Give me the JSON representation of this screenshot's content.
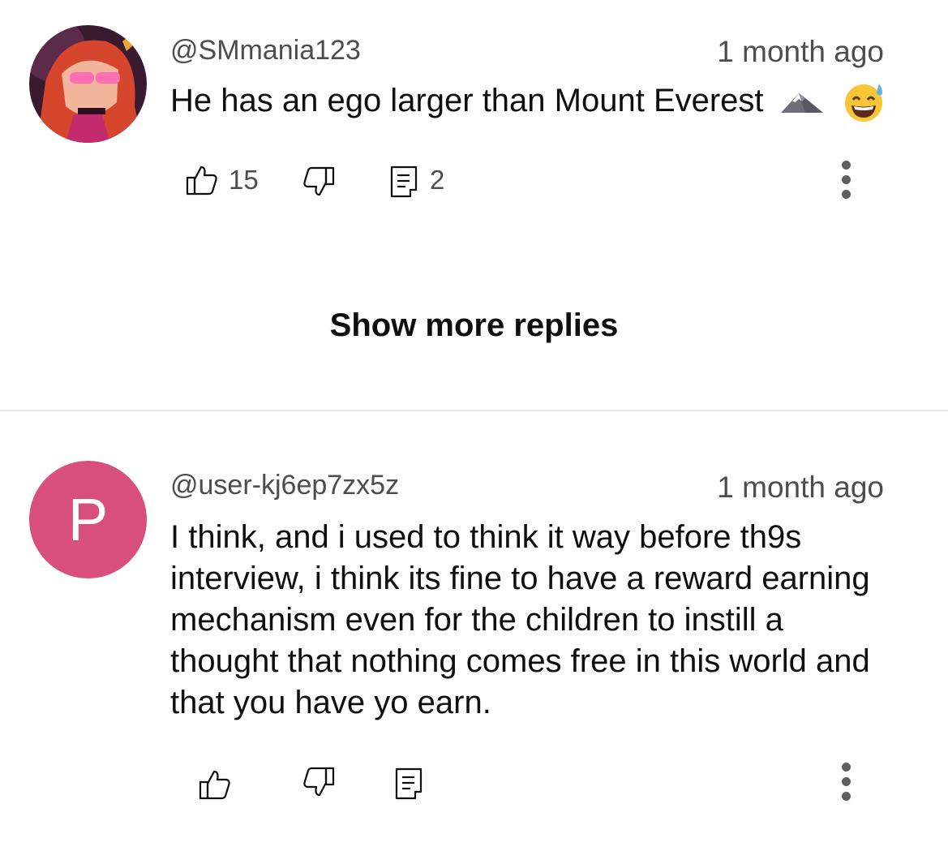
{
  "comments": [
    {
      "handle": "@SMmania123",
      "time": "1 month ago",
      "text": "He has an ego larger than Mount Everest",
      "emojis": [
        "mountain-emoji",
        "grinning-sweat-emoji"
      ],
      "likes": "15",
      "replies": "2",
      "avatar": "illustrated-avatar"
    },
    {
      "handle": "@user-kj6ep7zx5z",
      "time": "1 month ago",
      "text": "I think, and i used to think it way before th9s interview, i think its fine to have a reward earning mechanism even  for the children to instill a thought that nothing comes free in this world and that you have yo earn.",
      "avatar_letter": "P",
      "avatar_color": "#d94f7b"
    }
  ],
  "show_more_replies": "Show more replies",
  "icons": [
    "thumb-up-icon",
    "thumb-down-icon",
    "reply-icon",
    "more-options-icon"
  ]
}
